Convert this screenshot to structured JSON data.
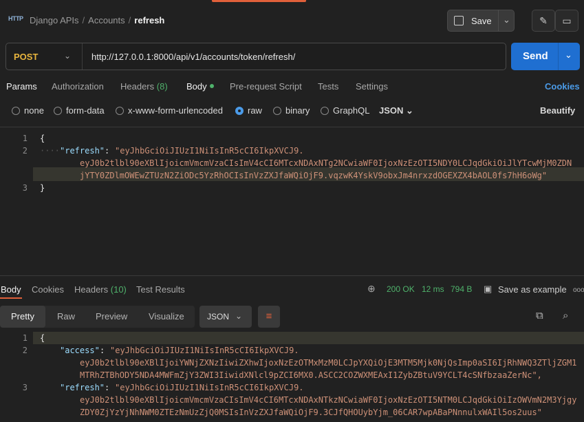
{
  "header": {
    "breadcrumb": [
      "Django APIs",
      "Accounts",
      "refresh"
    ],
    "save_label": "Save"
  },
  "request": {
    "method": "POST",
    "url": "http://127.0.0.1:8000/api/v1/accounts/token/refresh/",
    "send_label": "Send"
  },
  "tabs": {
    "params": "Params",
    "authorization": "Authorization",
    "headers": "Headers",
    "headers_count": "(8)",
    "body": "Body",
    "prerequest": "Pre-request Script",
    "tests": "Tests",
    "settings": "Settings",
    "cookies": "Cookies"
  },
  "body_types": {
    "none": "none",
    "form_data": "form-data",
    "urlencoded": "x-www-form-urlencoded",
    "raw": "raw",
    "binary": "binary",
    "graphql": "GraphQL",
    "format": "JSON",
    "beautify": "Beautify"
  },
  "request_body": {
    "line_numbers": [
      "1",
      "2",
      "3"
    ],
    "open": "{",
    "close": "}",
    "key": "\"refresh\"",
    "colon": ": ",
    "value_lines": [
      "\"eyJhbGciOiJIUzI1NiIsInR5cCI6IkpXVCJ9.",
      "eyJ0b2tlbl90eXBlIjoicmVmcmVzaCIsImV4cCI6MTcxNDAxNTg2NCwiaWF0IjoxNzEzOTI5NDY0LCJqdGkiOiJlYTcwMjM0ZDN",
      "jYTY0ZDlmOWEwZTUzN2ZiODc5YzRhOCIsInVzZXJfaWQiOjF9.vqzwK4YskV9obxJm4nrxzdOGEXZX4bAOL0fs7hH6oWg\""
    ]
  },
  "response_tabs": {
    "body": "Body",
    "cookies": "Cookies",
    "headers": "Headers",
    "headers_count": "(10)",
    "test_results": "Test Results"
  },
  "response_meta": {
    "status": "200 OK",
    "time": "12 ms",
    "size": "794 B",
    "save_example": "Save as example",
    "more": "ooo"
  },
  "view_modes": {
    "pretty": "Pretty",
    "raw": "Raw",
    "preview": "Preview",
    "visualize": "Visualize",
    "format": "JSON"
  },
  "response_body": {
    "line_numbers": [
      "1",
      "2",
      "3"
    ],
    "open": "{",
    "access_key": "\"access\"",
    "access_lines": [
      "\"eyJhbGciOiJIUzI1NiIsInR5cCI6IkpXVCJ9.",
      "eyJ0b2tlbl90eXBlIjoiYWNjZXNzIiwiZXhwIjoxNzEzOTMxMzM0LCJpYXQiOjE3MTM5Mjk0NjQsImp0aSI6IjRhNWQ3ZTljZGM1",
      "MTRhZTBhODY5NDA4MWFmZjY3ZWI3IiwidXNlcl9pZCI6MX0.ASCC2COZWXMEAxI1ZybZBtuV9YCLT4cSNfbzaaZerNc\","
    ],
    "refresh_key": "\"refresh\"",
    "refresh_lines": [
      "\"eyJhbGciOiJIUzI1NiIsInR5cCI6IkpXVCJ9.",
      "eyJ0b2tlbl90eXBlIjoicmVmcmVzaCIsImV4cCI6MTcxNDAxNTkzNCwiaWF0IjoxNzEzOTI5NTM0LCJqdGkiOiIzOWVmN2M3Yjgy",
      "ZDY0ZjYzYjNhNWM0ZTEzNmUzZjQ0MSIsInVzZXJfaWQiOjF9.3CJfQHOUybYjm_06CAR7wpABaPNnnulxWAIl5os2uus\""
    ]
  },
  "colors": {
    "accent": "#e0603a",
    "send": "#1f6fd1",
    "method": "#e8b53e",
    "status_ok": "#4fb26b",
    "link": "#4b9be8"
  }
}
